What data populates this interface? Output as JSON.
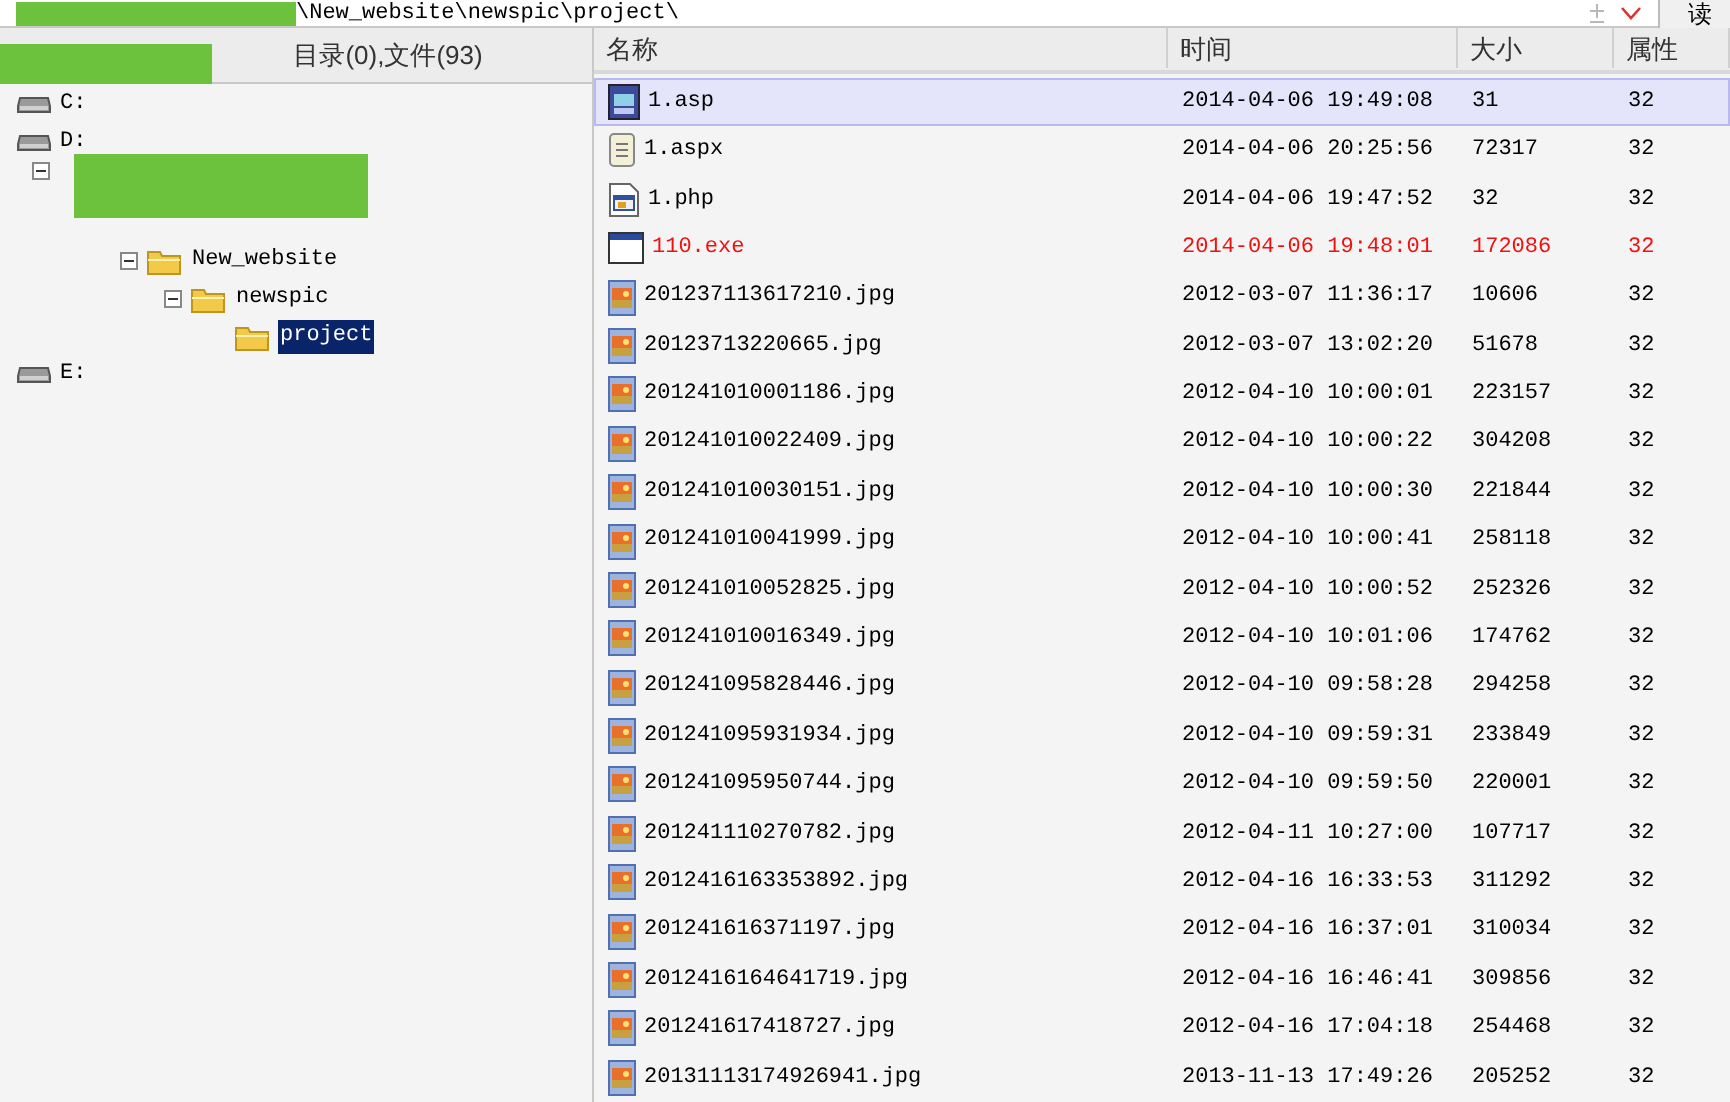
{
  "address_bar": {
    "path": "\\New_website\\newspic\\project\\",
    "read_button": "读"
  },
  "tree_panel": {
    "header": "目录(0),文件(93)",
    "tree": [
      {
        "label": "C:",
        "kind": "drive"
      },
      {
        "label": "D:",
        "kind": "drive",
        "children": [
          {
            "kind": "redacted",
            "expanded": true,
            "children": [
              {
                "label": "New_website",
                "kind": "folder",
                "expanded": true,
                "selected": false,
                "children": [
                  {
                    "label": "newspic",
                    "kind": "folder",
                    "expanded": true,
                    "selected": false,
                    "children": [
                      {
                        "label": "project",
                        "kind": "folder",
                        "selected": true
                      }
                    ]
                  }
                ]
              }
            ]
          }
        ]
      },
      {
        "label": "E:",
        "kind": "drive"
      }
    ]
  },
  "file_list": {
    "columns": [
      "名称",
      "时间",
      "大小",
      "属性"
    ],
    "rows": [
      {
        "name": "1.asp",
        "time": "2014-04-06 19:49:08",
        "size": "31",
        "attr": "32",
        "kind": "asp",
        "selected": true,
        "flagged": false
      },
      {
        "name": "1.aspx",
        "time": "2014-04-06 20:25:56",
        "size": "72317",
        "attr": "32",
        "kind": "aspx",
        "selected": false,
        "flagged": false
      },
      {
        "name": "1.php",
        "time": "2014-04-06 19:47:52",
        "size": "32",
        "attr": "32",
        "kind": "php",
        "selected": false,
        "flagged": false
      },
      {
        "name": "110.exe",
        "time": "2014-04-06 19:48:01",
        "size": "172086",
        "attr": "32",
        "kind": "exe",
        "selected": false,
        "flagged": true
      },
      {
        "name": "201237113617210.jpg",
        "time": "2012-03-07 11:36:17",
        "size": "10606",
        "attr": "32",
        "kind": "jpg",
        "selected": false,
        "flagged": false
      },
      {
        "name": "20123713220665.jpg",
        "time": "2012-03-07 13:02:20",
        "size": "51678",
        "attr": "32",
        "kind": "jpg",
        "selected": false,
        "flagged": false
      },
      {
        "name": "201241010001186.jpg",
        "time": "2012-04-10 10:00:01",
        "size": "223157",
        "attr": "32",
        "kind": "jpg",
        "selected": false,
        "flagged": false
      },
      {
        "name": "201241010022409.jpg",
        "time": "2012-04-10 10:00:22",
        "size": "304208",
        "attr": "32",
        "kind": "jpg",
        "selected": false,
        "flagged": false
      },
      {
        "name": "201241010030151.jpg",
        "time": "2012-04-10 10:00:30",
        "size": "221844",
        "attr": "32",
        "kind": "jpg",
        "selected": false,
        "flagged": false
      },
      {
        "name": "201241010041999.jpg",
        "time": "2012-04-10 10:00:41",
        "size": "258118",
        "attr": "32",
        "kind": "jpg",
        "selected": false,
        "flagged": false
      },
      {
        "name": "201241010052825.jpg",
        "time": "2012-04-10 10:00:52",
        "size": "252326",
        "attr": "32",
        "kind": "jpg",
        "selected": false,
        "flagged": false
      },
      {
        "name": "201241010016349.jpg",
        "time": "2012-04-10 10:01:06",
        "size": "174762",
        "attr": "32",
        "kind": "jpg",
        "selected": false,
        "flagged": false
      },
      {
        "name": "201241095828446.jpg",
        "time": "2012-04-10 09:58:28",
        "size": "294258",
        "attr": "32",
        "kind": "jpg",
        "selected": false,
        "flagged": false
      },
      {
        "name": "201241095931934.jpg",
        "time": "2012-04-10 09:59:31",
        "size": "233849",
        "attr": "32",
        "kind": "jpg",
        "selected": false,
        "flagged": false
      },
      {
        "name": "201241095950744.jpg",
        "time": "2012-04-10 09:59:50",
        "size": "220001",
        "attr": "32",
        "kind": "jpg",
        "selected": false,
        "flagged": false
      },
      {
        "name": "201241110270782.jpg",
        "time": "2012-04-11 10:27:00",
        "size": "107717",
        "attr": "32",
        "kind": "jpg",
        "selected": false,
        "flagged": false
      },
      {
        "name": "2012416163353892.jpg",
        "time": "2012-04-16 16:33:53",
        "size": "311292",
        "attr": "32",
        "kind": "jpg",
        "selected": false,
        "flagged": false
      },
      {
        "name": "201241616371197.jpg",
        "time": "2012-04-16 16:37:01",
        "size": "310034",
        "attr": "32",
        "kind": "jpg",
        "selected": false,
        "flagged": false
      },
      {
        "name": "2012416164641719.jpg",
        "time": "2012-04-16 16:46:41",
        "size": "309856",
        "attr": "32",
        "kind": "jpg",
        "selected": false,
        "flagged": false
      },
      {
        "name": "201241617418727.jpg",
        "time": "2012-04-16 17:04:18",
        "size": "254468",
        "attr": "32",
        "kind": "jpg",
        "selected": false,
        "flagged": false
      },
      {
        "name": "20131113174926941.jpg",
        "time": "2013-11-13 17:49:26",
        "size": "205252",
        "attr": "32",
        "kind": "jpg",
        "selected": false,
        "flagged": false
      }
    ]
  }
}
